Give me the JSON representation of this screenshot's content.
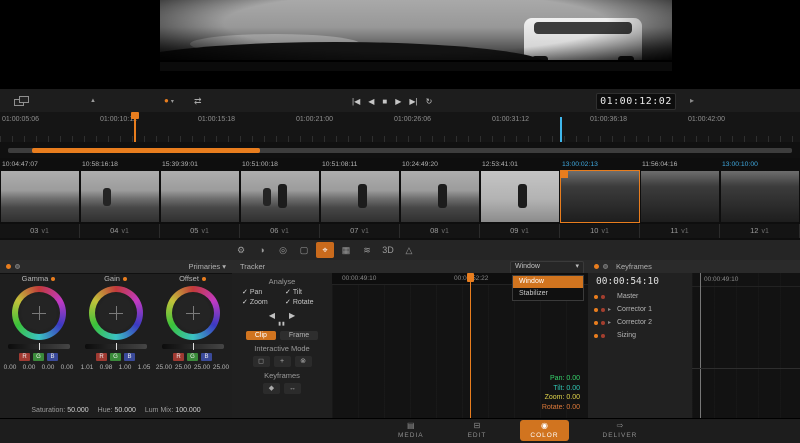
{
  "colors": {
    "accent": "#e87d1e",
    "timeline_blue": "#3fa9e0"
  },
  "icons": {
    "caret_down": "▾",
    "check": "✓",
    "play": "▶",
    "stop": "■",
    "step_back": "◀",
    "jump_start": "|◀",
    "jump_end": "▶|",
    "loop": "↻",
    "shuffle": "⇄",
    "clip_color": "●",
    "marker": "▲",
    "pause": "▮▮",
    "tri_left": "◀",
    "tri_right": "▶",
    "diamond": "◆",
    "h_arrows": "↔",
    "box": "◻",
    "plus": "+",
    "circle_x": "⊗",
    "expand": "▸",
    "viewer_more": "▸"
  },
  "viewer": {
    "timecode": "01:00:12:02"
  },
  "ruler": {
    "ticks": [
      "01:00:05:06",
      "01:00:10:12",
      "01:00:15:18",
      "01:00:21:00",
      "01:00:26:06",
      "01:00:31:12",
      "01:00:36:18",
      "01:00:42:00"
    ]
  },
  "clips": [
    {
      "num": "03",
      "ver": "v1",
      "tc": "10:04:47:07",
      "tc_color": "#b4b4b4"
    },
    {
      "num": "04",
      "ver": "v1",
      "tc": "10:58:16:18",
      "tc_color": "#b4b4b4"
    },
    {
      "num": "05",
      "ver": "v1",
      "tc": "15:39:39:01",
      "tc_color": "#b4b4b4"
    },
    {
      "num": "06",
      "ver": "v1",
      "tc": "10:51:00:18",
      "tc_color": "#b4b4b4"
    },
    {
      "num": "07",
      "ver": "v1",
      "tc": "10:51:08:11",
      "tc_color": "#b4b4b4"
    },
    {
      "num": "08",
      "ver": "v1",
      "tc": "10:24:49:20",
      "tc_color": "#b4b4b4"
    },
    {
      "num": "09",
      "ver": "v1",
      "tc": "12:53:41:01",
      "tc_color": "#b4b4b4"
    },
    {
      "num": "10",
      "ver": "v1",
      "tc": "13:00:02:13",
      "tc_color": "#3fa9e0",
      "selected": true
    },
    {
      "num": "11",
      "ver": "v1",
      "tc": "11:56:04:16",
      "tc_color": "#b4b4b4"
    },
    {
      "num": "12",
      "ver": "v1",
      "tc": "13:00:10:00",
      "tc_color": "#3fa9e0"
    }
  ],
  "toolbar": {
    "icons": [
      {
        "name": "camera-raw",
        "glyph": "⚙"
      },
      {
        "name": "curves",
        "glyph": "◑"
      },
      {
        "name": "qualifier",
        "glyph": "◎"
      },
      {
        "name": "power-window",
        "glyph": "▢"
      },
      {
        "name": "tracker",
        "glyph": "⌖",
        "active": true
      },
      {
        "name": "sizing",
        "glyph": "▦"
      },
      {
        "name": "blur",
        "glyph": "≋"
      },
      {
        "name": "stereo-3d",
        "glyph": "3D"
      },
      {
        "name": "motion-effects",
        "glyph": "△"
      }
    ]
  },
  "primaries": {
    "title": "Primaries",
    "wheels": [
      {
        "label": "Gamma",
        "values": [
          "0.00",
          "0.00",
          "0.00",
          "0.00"
        ]
      },
      {
        "label": "Gain",
        "values": [
          "1.01",
          "0.98",
          "1.00",
          "1.05"
        ]
      },
      {
        "label": "Offset",
        "values": [
          "25.00",
          "25.00",
          "25.00",
          "25.00"
        ]
      }
    ],
    "chips": [
      "R",
      "G",
      "B"
    ],
    "saturation_label": "Saturation:",
    "saturation": "50.000",
    "hue_label": "Hue:",
    "hue": "50.000",
    "lum_label": "Lum Mix:",
    "lum": "100.000"
  },
  "tracker": {
    "title": "Tracker",
    "analyse": "Analyse",
    "checks": [
      "Pan",
      "Tilt",
      "Zoom",
      "Rotate"
    ],
    "clip": "Clip",
    "frame": "Frame",
    "interactive": "Interactive Mode",
    "keyframes": "Keyframes",
    "dropdown": {
      "value": "Window",
      "items": [
        "Window",
        "Stabilizer"
      ]
    },
    "graph": {
      "tc1": "00:00:49:10",
      "tc2": "00:00:52:22",
      "readouts": [
        {
          "label": "Pan:",
          "value": "0.00",
          "color": "#35d06a"
        },
        {
          "label": "Tilt:",
          "value": "0.00",
          "color": "#2fc4b2"
        },
        {
          "label": "Zoom:",
          "value": "0.00",
          "color": "#ded24a"
        },
        {
          "label": "Rotate:",
          "value": "0.00",
          "color": "#de7a3a"
        }
      ]
    }
  },
  "keyframes_panel": {
    "title": "Keyframes",
    "timecode": "00:00:54:10",
    "ruler_tc": "00:00:49:10",
    "tracks": [
      {
        "name": "Master"
      },
      {
        "name": "Corrector 1"
      },
      {
        "name": "Corrector 2"
      },
      {
        "name": "Sizing"
      }
    ]
  },
  "nav": {
    "items": [
      {
        "label": "MEDIA",
        "glyph": "▤"
      },
      {
        "label": "EDIT",
        "glyph": "⊟"
      },
      {
        "label": "COLOR",
        "glyph": "◉",
        "active": true
      },
      {
        "label": "DELIVER",
        "glyph": "⇨"
      }
    ]
  }
}
